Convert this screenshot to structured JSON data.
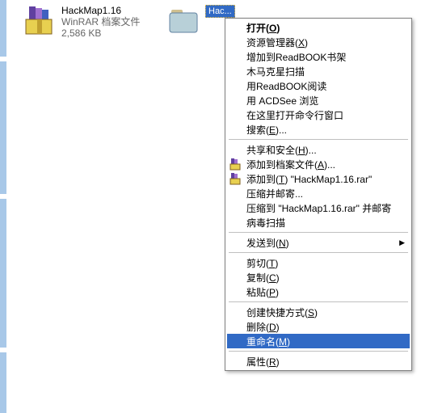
{
  "files": {
    "rar": {
      "name": "HackMap1.16",
      "type": "WinRAR 档案文件",
      "size": "2,586 KB"
    },
    "folder": {
      "label_partial": "Hac..."
    }
  },
  "menu": {
    "open": "打开(O)",
    "explorer": "资源管理器(X)",
    "add_readbook": "增加到ReadBOOK书架",
    "trojan_scan": "木马克星扫描",
    "use_readbook": "用ReadBOOK阅读",
    "acdsee": "用 ACDSee 浏览",
    "cmd_here": "在这里打开命令行窗口",
    "search": "搜索(E)...",
    "share_sec": "共享和安全(H)...",
    "add_archive": "添加到档案文件(A)...",
    "add_to_rar": "添加到(T) \"HackMap1.16.rar\"",
    "zip_mail": "压缩并邮寄...",
    "zip_to_mail": "压缩到 \"HackMap1.16.rar\" 并邮寄",
    "virus_scan": "病毒扫描",
    "send_to": "发送到(N)",
    "cut": "剪切(T)",
    "copy": "复制(C)",
    "paste": "粘贴(P)",
    "shortcut": "创建快捷方式(S)",
    "delete": "删除(D)",
    "rename": "重命名(M)",
    "properties": "属性(R)"
  }
}
